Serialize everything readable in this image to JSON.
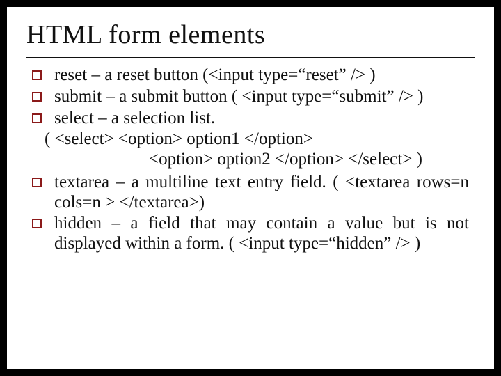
{
  "title": "HTML form elements",
  "bullets": {
    "b1": "reset – a reset button (<input type=“reset” /> )",
    "b2": "submit – a submit button ( <input type=“submit” /> )",
    "b3": "select – a selection list.",
    "b4": "textarea – a multiline text entry field. ( <textarea  rows=n cols=n > </textarea>)",
    "b5": "hidden – a field that may contain a value but is not displayed within a form. ( <input type=“hidden” /> )"
  },
  "code": {
    "line1": "( <select> <option> option1 </option>",
    "line2": "<option> option2 </option>  </select> )"
  }
}
